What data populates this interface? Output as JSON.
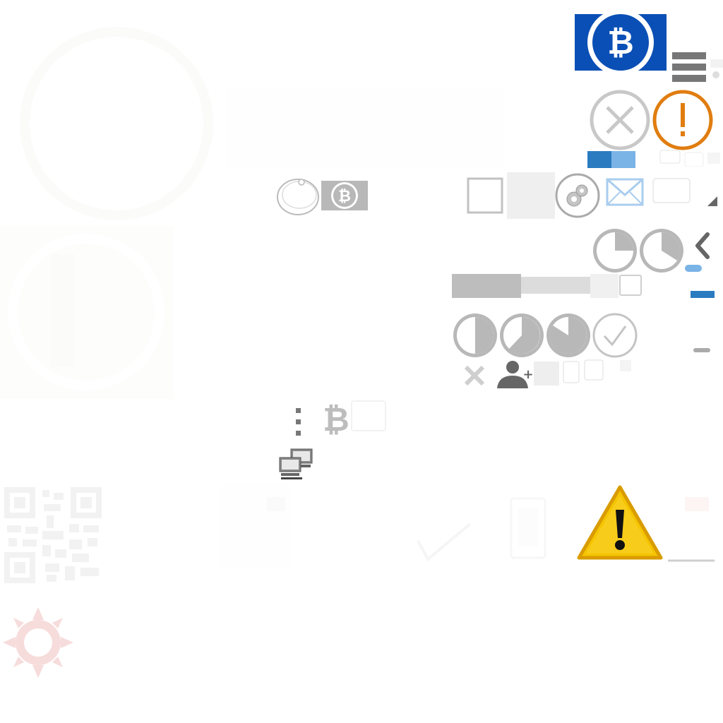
{
  "sheet": {
    "description_free": true
  },
  "icons": [
    {
      "name": "bitcoin-cash-logo-icon"
    },
    {
      "name": "hamburger-menu-icon"
    },
    {
      "name": "close-circle-icon"
    },
    {
      "name": "warning-circle-icon"
    },
    {
      "name": "checkmark-icon"
    },
    {
      "name": "bitcoin-coin-badge-icon"
    },
    {
      "name": "gear-circle-icon"
    },
    {
      "name": "mail-icon"
    },
    {
      "name": "checkbox-icon"
    },
    {
      "name": "chevron-left-icon"
    },
    {
      "name": "progress-pie-icon"
    },
    {
      "name": "check-circle-icon"
    },
    {
      "name": "x-icon"
    },
    {
      "name": "add-user-icon"
    },
    {
      "name": "vertical-dots-icon"
    },
    {
      "name": "bitcoin-symbol-icon"
    },
    {
      "name": "network-computers-icon"
    },
    {
      "name": "warning-triangle-icon"
    },
    {
      "name": "qr-code-icon"
    },
    {
      "name": "sun-icon"
    }
  ],
  "progress_pies": {
    "row1": [
      0.25,
      0.35
    ],
    "row2": [
      0.5,
      0.6,
      0.85,
      1.0
    ]
  },
  "colors": {
    "bitcoin_blue": "#0a4fb5",
    "warning_orange": "#e07d10",
    "warning_yellow": "#f5c400",
    "check_green": "#8fdd4a",
    "gray": "#888888",
    "light_gray": "#bdbdbd",
    "swatch_blue_dark": "#2b7bc0",
    "swatch_blue_light": "#7ab3e6",
    "mail_blue": "#a9cdee",
    "sun_red": "#f7dcdc"
  }
}
